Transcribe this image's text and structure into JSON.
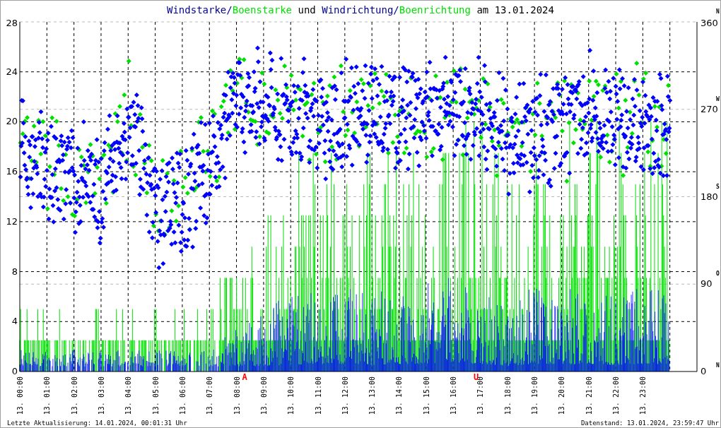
{
  "title_parts": [
    {
      "text": "Windstarke",
      "color": "#000099"
    },
    {
      "text": "/",
      "color": "#000099"
    },
    {
      "text": "Boenstarke",
      "color": "#00e000"
    },
    {
      "text": " und ",
      "color": "#000000"
    },
    {
      "text": "Windrichtung",
      "color": "#000099"
    },
    {
      "text": "/",
      "color": "#000099"
    },
    {
      "text": "Boenrichtung",
      "color": "#00e000"
    },
    {
      "text": " am 13.01.2024",
      "color": "#000000"
    }
  ],
  "left_axis": [
    "28",
    "24",
    "20",
    "16",
    "12",
    "8",
    "4",
    "0"
  ],
  "right_axis": [
    {
      "label": "360",
      "compass": "N"
    },
    {
      "label": "270",
      "compass": "W"
    },
    {
      "label": "180",
      "compass": "S"
    },
    {
      "label": "90",
      "compass": "O"
    },
    {
      "label": "0",
      "compass": "N"
    }
  ],
  "x_labels": [
    "13. 00:00",
    "13. 01:00",
    "13. 02:00",
    "13. 03:00",
    "13. 04:00",
    "13. 05:00",
    "13. 06:00",
    "13. 07:00",
    "13. 08:00",
    "13. 09:00",
    "13. 10:00",
    "13. 11:00",
    "13. 12:00",
    "13. 13:00",
    "13. 14:00",
    "13. 15:00",
    "13. 16:00",
    "13. 17:00",
    "13. 18:00",
    "13. 19:00",
    "13. 20:00",
    "13. 21:00",
    "13. 22:00",
    "13. 23:00"
  ],
  "markers": [
    {
      "label": "A",
      "color": "#ff0000"
    },
    {
      "label": "U",
      "color": "#ff0000"
    }
  ],
  "footer": {
    "left": "Letzte Aktualisierung: 14.01.2024, 00:01:31 Uhr",
    "right": "Datenstand: 13.01.2024, 23:59:47 Uhr"
  }
}
